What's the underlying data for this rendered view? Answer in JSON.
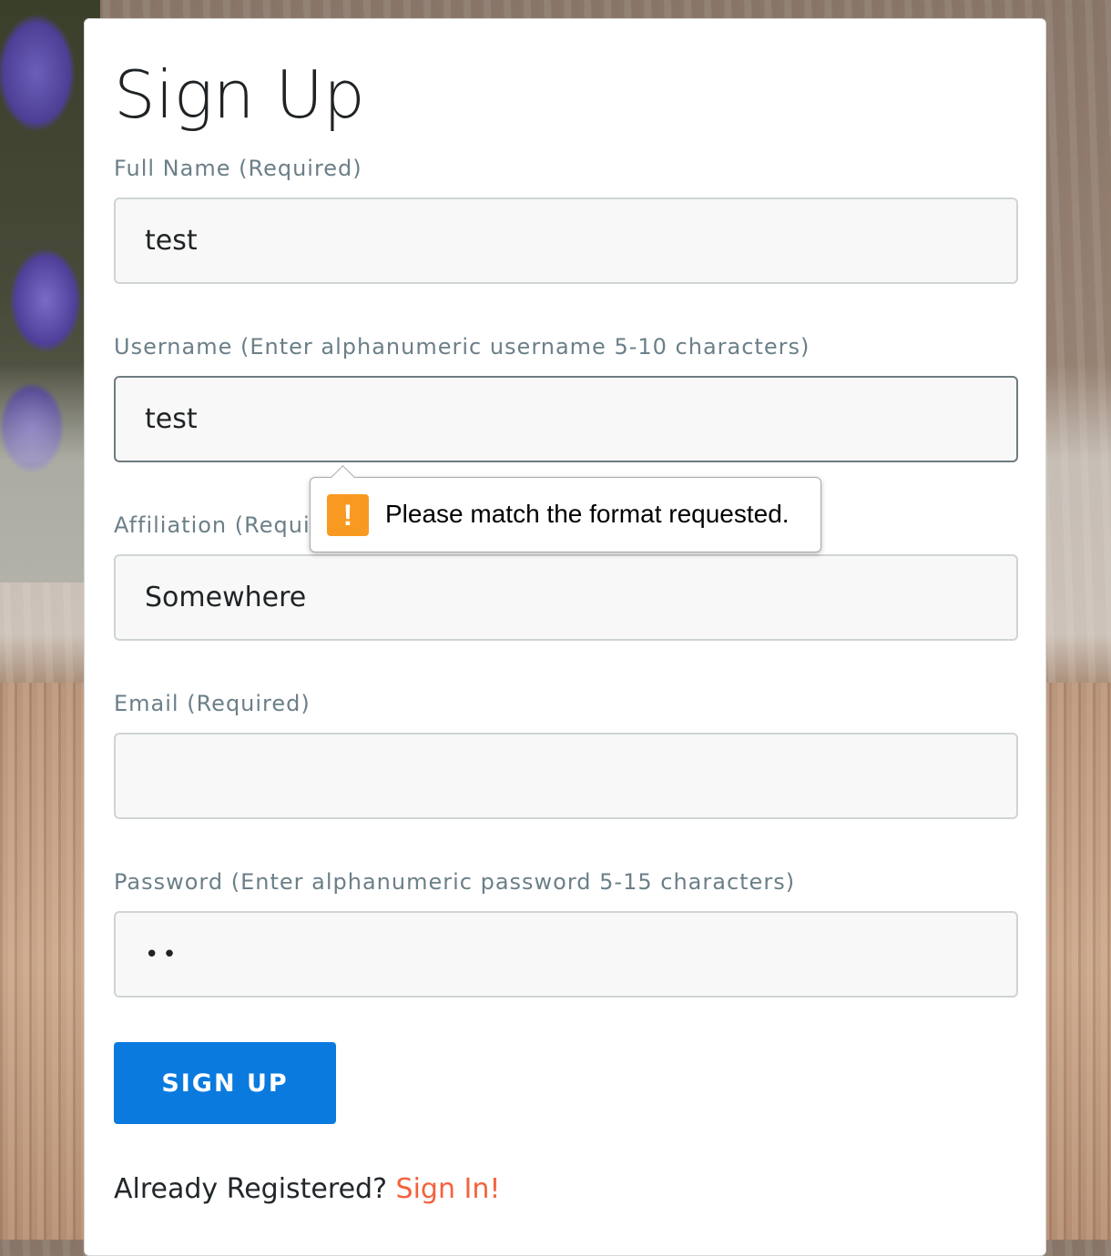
{
  "form": {
    "title": "Sign Up",
    "fields": [
      {
        "label": "Full Name (Required)",
        "value": "test"
      },
      {
        "label": "Username (Enter alphanumeric username 5-10 characters)",
        "value": "test"
      },
      {
        "label": "Affiliation (Required)",
        "value": "Somewhere"
      },
      {
        "label": "Email (Required)",
        "value": ""
      },
      {
        "label": "Password (Enter alphanumeric password 5-15 characters)",
        "value": "••"
      }
    ],
    "submit_label": "SIGN UP",
    "footer": {
      "prompt": "Already Registered?",
      "link": "Sign In!"
    }
  },
  "validation": {
    "message": "Please match the format requested.",
    "icon": "warning-icon",
    "icon_glyph": "!",
    "icon_color": "#f89a21"
  },
  "colors": {
    "primary_button": "#0a7ade",
    "link": "#f2633d",
    "label": "#6b7f88"
  }
}
